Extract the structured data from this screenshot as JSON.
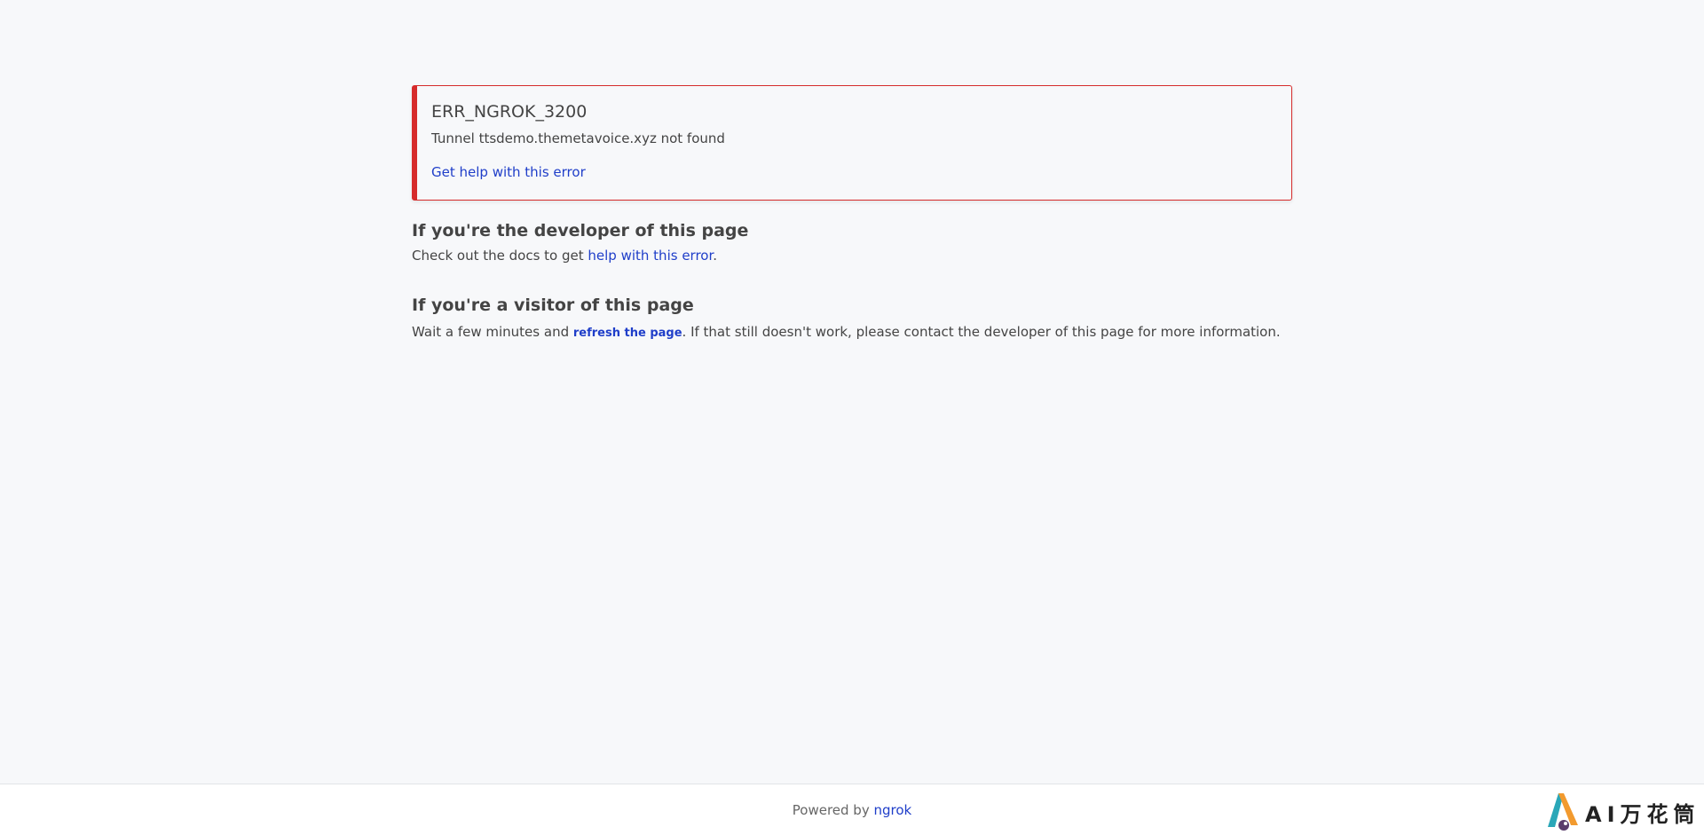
{
  "error": {
    "code": "ERR_NGROK_3200",
    "message": "Tunnel ttsdemo.themetavoice.xyz not found",
    "help_link": "Get help with this error"
  },
  "developer": {
    "title": "If you're the developer of this page",
    "text_before": "Check out the docs to get ",
    "link": "help with this error",
    "text_after": "."
  },
  "visitor": {
    "title": "If you're a visitor of this page",
    "text_before": "Wait a few minutes and ",
    "link": "refresh the page",
    "text_after": ". If that still doesn't work, please contact the developer of this page for more information."
  },
  "footer": {
    "prefix": "Powered by ",
    "link": "ngrok"
  },
  "watermark": {
    "text": "AI万花筒"
  },
  "colors": {
    "error_border": "#d62b2b",
    "link": "#1f3ec9",
    "background": "#f7f8fa"
  }
}
